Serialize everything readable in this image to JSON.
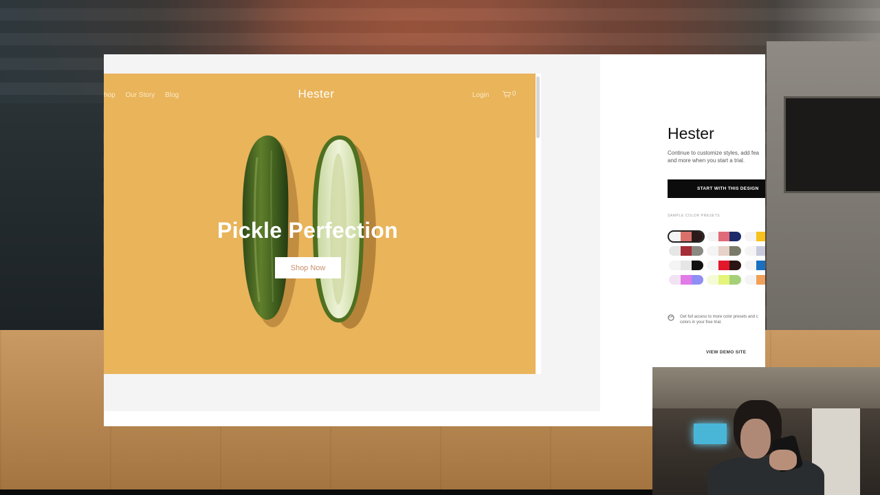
{
  "site": {
    "nav_left": [
      "hop",
      "Our Story",
      "Blog"
    ],
    "logo": "Hester",
    "login": "Login",
    "cart_count": "0",
    "hero_title": "Pickle Perfection",
    "hero_button": "Shop Now",
    "background_color": "#e9b45a"
  },
  "panel": {
    "title": "Hester",
    "description_line1": "Continue to customize styles, add fea",
    "description_line2": "and more when you start a trial.",
    "cta": "START WITH THIS DESIGN",
    "presets_heading": "SAMPLE COLOR PRESETS",
    "note_line1": "Get full access to more color presets and c",
    "note_line2": "colors in your free trial.",
    "demo_link": "VIEW DEMO SITE",
    "presets": [
      {
        "colors": [
          "#f4f4f4",
          "#d9716a",
          "#2b1a1a"
        ],
        "selected": true
      },
      {
        "colors": [
          "#f4f4f4",
          "#e06a78",
          "#1e2c6a"
        ],
        "selected": false
      },
      {
        "colors": [
          "#f4f4f4",
          "#f6c21b",
          "#f6c21b"
        ],
        "selected": false
      },
      {
        "colors": [
          "#e6e6e6",
          "#a52e38",
          "#8a8a82"
        ],
        "selected": false
      },
      {
        "colors": [
          "#f4f4f4",
          "#e6d2c8",
          "#7a7a6a"
        ],
        "selected": false
      },
      {
        "colors": [
          "#f4f4f4",
          "#c9c9dd",
          "#c9c9dd"
        ],
        "selected": false
      },
      {
        "colors": [
          "#f4f4f4",
          "#e6e6e6",
          "#111111"
        ],
        "selected": false
      },
      {
        "colors": [
          "#f4f4f4",
          "#e3172a",
          "#2a1414"
        ],
        "selected": false
      },
      {
        "colors": [
          "#f4f4f4",
          "#1b6fc0",
          "#1b6fc0"
        ],
        "selected": false
      },
      {
        "colors": [
          "#f1e3f3",
          "#e27ae8",
          "#8f8ef5"
        ],
        "selected": false
      },
      {
        "colors": [
          "#f4fbd6",
          "#e5f47a",
          "#a5d07a"
        ],
        "selected": false
      },
      {
        "colors": [
          "#f4f4f4",
          "#f0a05a",
          "#f0a05a"
        ],
        "selected": false
      }
    ]
  }
}
